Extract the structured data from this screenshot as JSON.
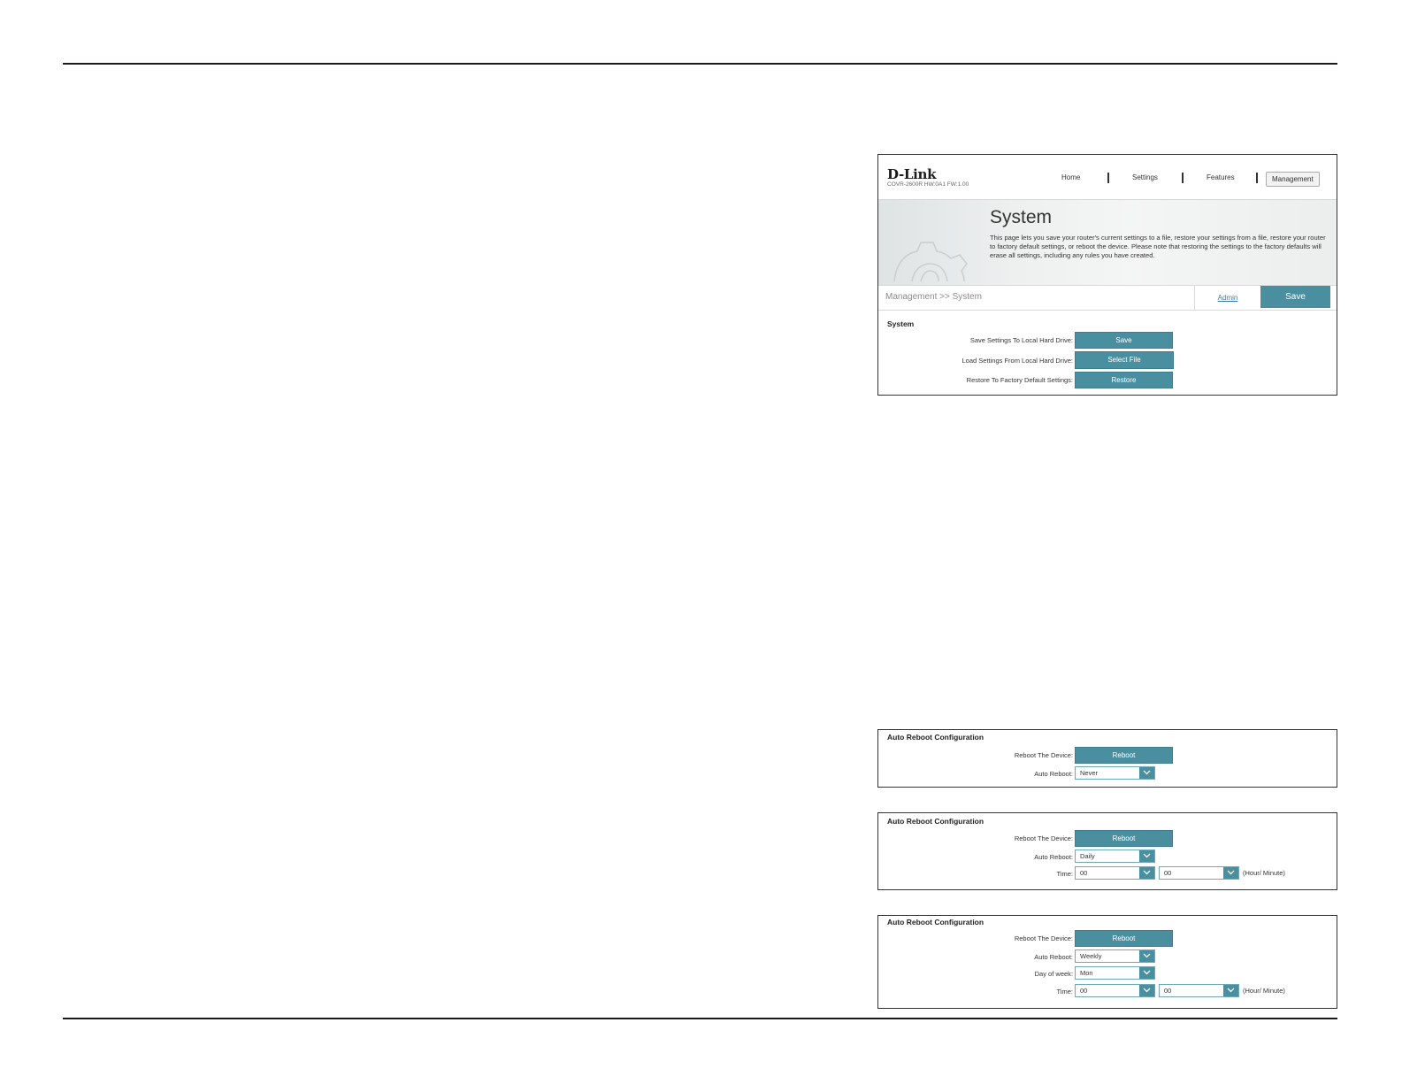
{
  "main": {
    "logo": "D-Link",
    "model": "COVR-2600R HW:0A1 FW:1.00",
    "nav": [
      "Home",
      "Settings",
      "Features",
      "Management"
    ],
    "title": "System",
    "description": "This page lets you save your router's current settings to a file, restore your settings from a file, restore your router to factory default settings, or reboot the device. Please note that restoring the settings to the factory defaults will erase all settings, including any rules you have created.",
    "breadcrumb": "Management >> System",
    "admin_link": "Admin",
    "save_button": "Save",
    "section_title": "System",
    "rows": [
      {
        "label": "Save Settings To Local Hard Drive:",
        "button": "Save"
      },
      {
        "label": "Load Settings From Local Hard Drive:",
        "button": "Select File"
      },
      {
        "label": "Restore To Factory Default Settings:",
        "button": "Restore"
      }
    ]
  },
  "panels": [
    {
      "title": "Auto Reboot Configuration",
      "reboot_label": "Reboot The Device:",
      "reboot_button": "Reboot",
      "auto_label": "Auto Reboot:",
      "auto_value": "Never"
    },
    {
      "title": "Auto Reboot Configuration",
      "reboot_label": "Reboot The Device:",
      "reboot_button": "Reboot",
      "auto_label": "Auto Reboot:",
      "auto_value": "Daily",
      "time_label": "Time:",
      "hour": "00",
      "minute": "00",
      "unit": "(Hour/ Minute)"
    },
    {
      "title": "Auto Reboot Configuration",
      "reboot_label": "Reboot The Device:",
      "reboot_button": "Reboot",
      "auto_label": "Auto Reboot:",
      "auto_value": "Weekly",
      "day_label": "Day of week:",
      "day_value": "Mon",
      "time_label": "Time:",
      "hour": "00",
      "minute": "00",
      "unit": "(Hour/ Minute)"
    }
  ],
  "colors": {
    "accent": "#4a8fa0",
    "rule": "#1a1a1a"
  }
}
